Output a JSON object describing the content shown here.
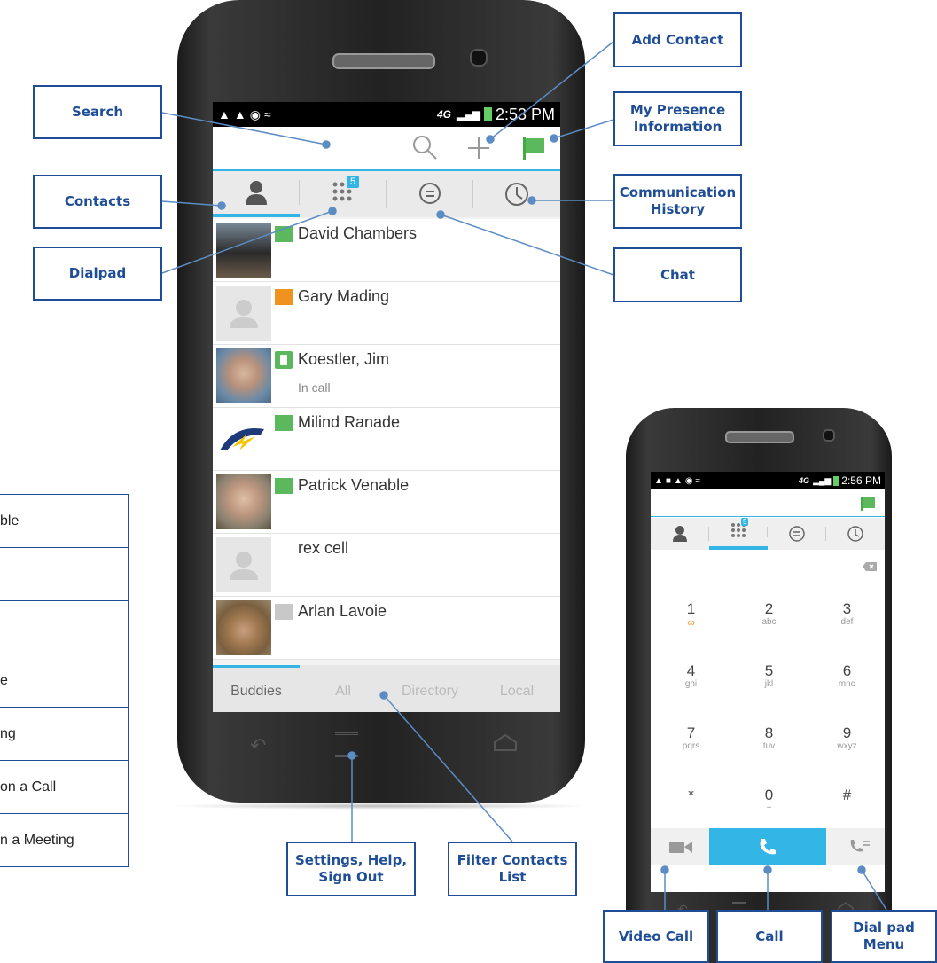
{
  "callouts": {
    "search": "Search",
    "add_contact": "Add Contact",
    "my_presence": "My Presence Information",
    "contacts": "Contacts",
    "communication_history": "Communication History",
    "dialpad": "Dialpad",
    "chat": "Chat",
    "settings": "Settings, Help, Sign Out",
    "filter_contacts": "Filter Contacts List",
    "video_call": "Video Call",
    "call": "Call",
    "dial_pad_menu": "Dial pad Menu"
  },
  "legend": [
    "ble",
    "",
    "",
    "e",
    "ng",
    "on a Call",
    "n a Meeting"
  ],
  "phone1": {
    "status_time": "2:53 PM",
    "network": "4G",
    "dialpad_badge": "5",
    "contacts": [
      {
        "name": "David Chambers",
        "sub": "",
        "flag": "green",
        "avatar": "photo-dark"
      },
      {
        "name": "Gary Mading",
        "sub": "",
        "flag": "orange",
        "avatar": "placeholder"
      },
      {
        "name": "Koestler, Jim",
        "sub": "In call",
        "flag": "phone-green",
        "avatar": "photo-man"
      },
      {
        "name": "Milind Ranade",
        "sub": "",
        "flag": "green",
        "avatar": "bolt-logo"
      },
      {
        "name": "Patrick Venable",
        "sub": "",
        "flag": "green",
        "avatar": "photo-man2"
      },
      {
        "name": "rex cell",
        "sub": "",
        "flag": "none",
        "avatar": "placeholder"
      },
      {
        "name": "Arlan Lavoie",
        "sub": "",
        "flag": "gray",
        "avatar": "photo-hat"
      }
    ],
    "filters": [
      "Buddies",
      "All",
      "Directory",
      "Local"
    ]
  },
  "phone2": {
    "status_time": "2:56 PM",
    "network": "4G",
    "dialpad_badge": "5",
    "keys": [
      {
        "digit": "1",
        "letters": "voicemail"
      },
      {
        "digit": "2",
        "letters": "abc"
      },
      {
        "digit": "3",
        "letters": "def"
      },
      {
        "digit": "4",
        "letters": "ghi"
      },
      {
        "digit": "5",
        "letters": "jkl"
      },
      {
        "digit": "6",
        "letters": "mno"
      },
      {
        "digit": "7",
        "letters": "pqrs"
      },
      {
        "digit": "8",
        "letters": "tuv"
      },
      {
        "digit": "9",
        "letters": "wxyz"
      },
      {
        "digit": "*",
        "letters": ""
      },
      {
        "digit": "0",
        "letters": "+"
      },
      {
        "digit": "#",
        "letters": ""
      }
    ]
  },
  "colors": {
    "accent": "#33b5e5",
    "callout": "#1f4e96",
    "flag_green": "#5cb85c",
    "flag_orange": "#f0931e"
  }
}
